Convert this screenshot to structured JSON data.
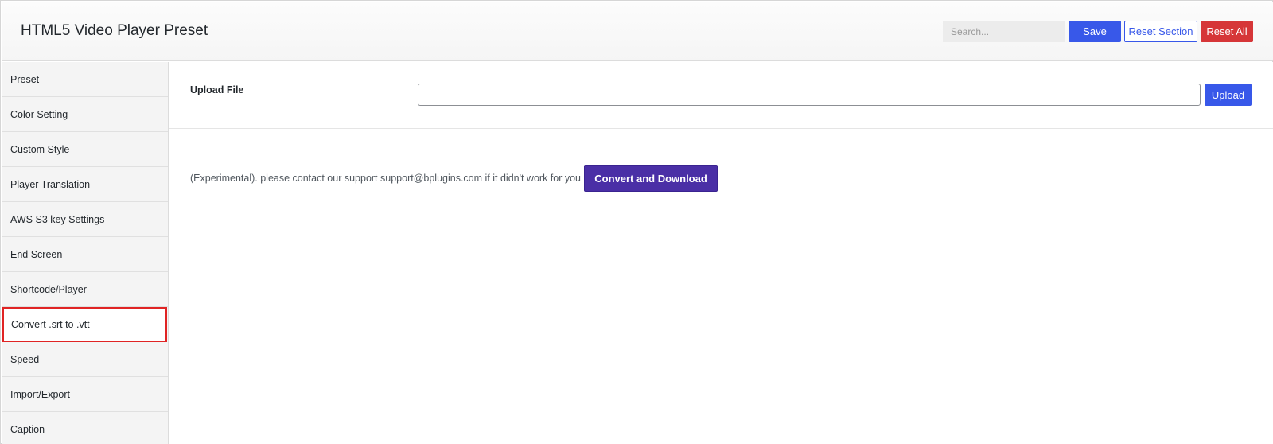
{
  "header": {
    "title": "HTML5 Video Player Preset",
    "search_placeholder": "Search...",
    "save_label": "Save",
    "reset_section_label": "Reset Section",
    "reset_all_label": "Reset All"
  },
  "sidebar": {
    "items": [
      {
        "label": "Preset"
      },
      {
        "label": "Color Setting"
      },
      {
        "label": "Custom Style"
      },
      {
        "label": "Player Translation"
      },
      {
        "label": "AWS S3 key Settings"
      },
      {
        "label": "End Screen"
      },
      {
        "label": "Shortcode/Player"
      },
      {
        "label": "Convert .srt to .vtt",
        "active": true
      },
      {
        "label": "Speed"
      },
      {
        "label": "Import/Export"
      },
      {
        "label": "Caption"
      }
    ]
  },
  "main": {
    "upload_label": "Upload File",
    "upload_value": "",
    "upload_button": "Upload",
    "convert_text": "(Experimental). please contact our support support@bplugins.com if it didn't work for you",
    "convert_button": "Convert and Download"
  },
  "colors": {
    "primary": "#3858e9",
    "danger": "#d63638",
    "convert": "#4a2fa6",
    "active_outline": "#e02424"
  }
}
